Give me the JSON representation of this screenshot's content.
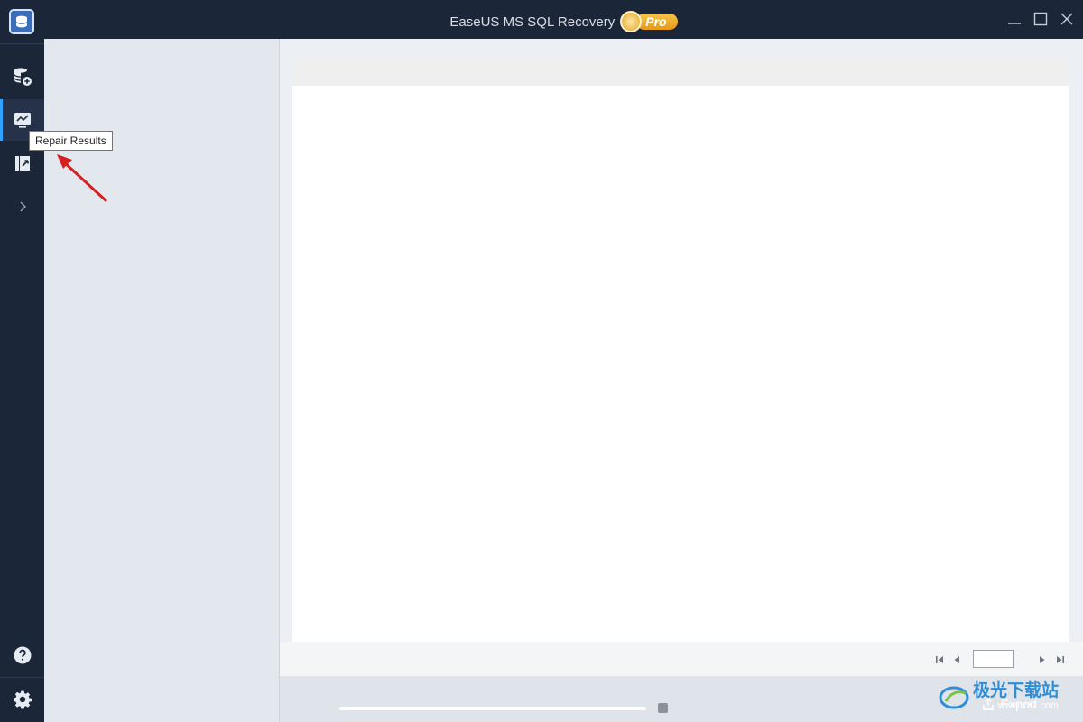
{
  "app": {
    "title": "EaseUS MS SQL Recovery",
    "edition_badge": "Pro"
  },
  "rail": {
    "items": [
      {
        "icon": "database-add-icon"
      },
      {
        "icon": "repair-results-icon",
        "active": true
      },
      {
        "icon": "export-log-icon"
      },
      {
        "icon": "chevron-right-icon"
      }
    ],
    "bottom": [
      {
        "icon": "help-icon"
      },
      {
        "icon": "settings-icon"
      }
    ]
  },
  "tooltip": {
    "text": "Repair Results"
  },
  "pager": {
    "page_value": ""
  },
  "bottom_bar": {
    "progress": 0,
    "export_label": "Export"
  },
  "watermark": {
    "brand_text": "极光下载站",
    "url_text": "www.xz7.com"
  },
  "colors": {
    "rail_bg": "#1b2638",
    "accent": "#2fa3ff",
    "pro_badge": "#e59a16",
    "annotation_arrow": "#d62020"
  }
}
